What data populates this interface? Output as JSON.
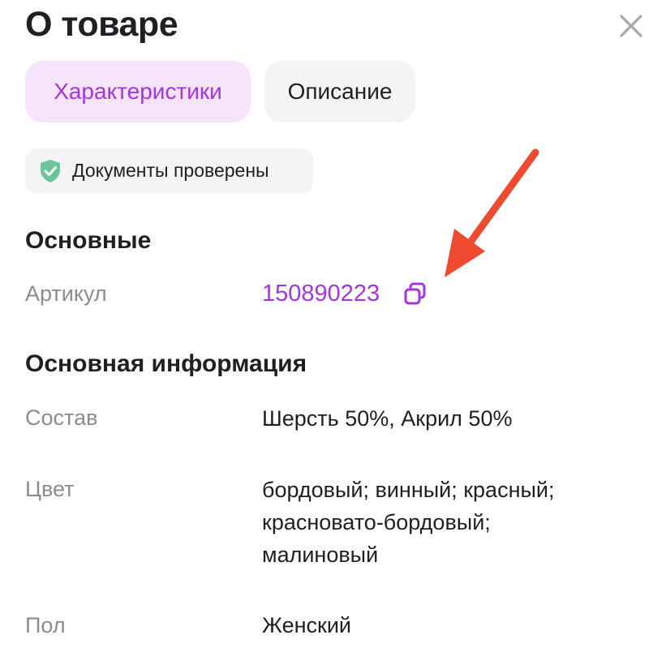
{
  "header": {
    "title": "О товаре"
  },
  "tabs": [
    {
      "label": "Характеристики",
      "active": true
    },
    {
      "label": "Описание",
      "active": false
    }
  ],
  "verified_badge": {
    "text": "Документы проверены",
    "icon": "shield-check-icon"
  },
  "sections": {
    "main": {
      "title": "Основные",
      "article_label": "Артикул",
      "article_value": "150890223"
    },
    "info": {
      "title": "Основная информация",
      "rows": [
        {
          "label": "Состав",
          "value": "Шерсть 50%, Акрил 50%"
        },
        {
          "label": "Цвет",
          "value_lines": [
            "бордовый; винный; красный;",
            "красновато-бордовый;",
            "малиновый"
          ]
        },
        {
          "label": "Пол",
          "value": "Женский"
        }
      ]
    }
  },
  "colors": {
    "accent": "#a535e0",
    "tab_active_bg": "#f6e3fc",
    "badge_green": "#6cc598",
    "arrow": "#ee4a2f"
  },
  "icons": {
    "close": "close-icon",
    "copy": "copy-icon",
    "annotation": "arrow-annotation"
  }
}
